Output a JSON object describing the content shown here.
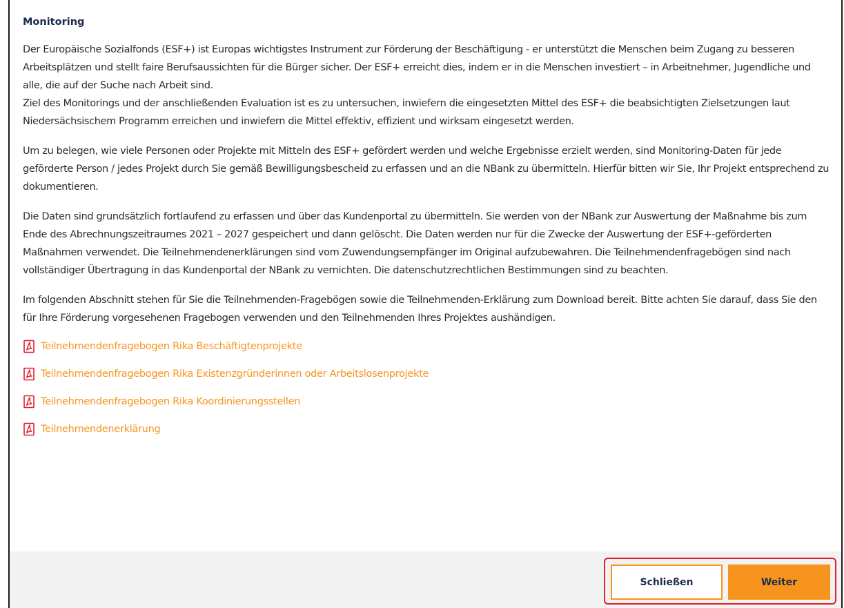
{
  "dialog": {
    "title": "Monitoring",
    "paragraphs": [
      "Der Europäische Sozialfonds (ESF+) ist Europas wichtigstes Instrument zur Förderung der Beschäftigung - er unterstützt die Menschen beim Zugang zu besseren Arbeitsplätzen und stellt faire Berufsaussichten für die Bürger sicher. Der ESF+ erreicht dies, indem er in die Menschen investiert – in Arbeitnehmer, Jugendliche und alle, die auf der Suche nach Arbeit sind.\nZiel des Monitorings und der anschließenden Evaluation ist es zu untersuchen, inwiefern die eingesetzten Mittel des ESF+ die beabsichtigten Zielsetzungen laut Niedersächsischem Programm erreichen und inwiefern die Mittel effektiv, effizient und wirksam eingesetzt werden.",
      "Um zu belegen, wie viele Personen oder Projekte mit Mitteln des ESF+ gefördert werden und welche Ergebnisse erzielt werden, sind Monitoring-Daten für jede geförderte Person / jedes Projekt durch Sie gemäß Bewilligungsbescheid zu erfassen und an die NBank zu übermitteln. Hierfür bitten wir Sie, Ihr Projekt entsprechend zu dokumentieren.",
      "Die Daten sind grundsätzlich fortlaufend zu erfassen und über das Kundenportal zu übermitteln. Sie werden von der NBank zur Auswertung der Maßnahme bis zum Ende des Abrechnungszeitraumes 2021 – 2027 gespeichert und dann gelöscht. Die Daten werden nur für die Zwecke der Auswertung der ESF+-geförderten Maßnahmen verwendet. Die Teilnehmendenerklärungen sind vom Zuwendungsempfänger im Original aufzubewahren. Die Teilnehmendenfragebögen sind nach vollständiger Übertragung in das Kundenportal der NBank zu vernichten. Die datenschutzrechtlichen Bestimmungen sind zu beachten.",
      "Im folgenden Abschnitt stehen für Sie die Teilnehmenden-Fragebögen sowie die Teilnehmenden-Erklärung zum Download bereit. Bitte achten Sie darauf, dass Sie den für Ihre Förderung vorgesehenen Fragebogen verwenden und den Teilnehmenden Ihres Projektes aushändigen."
    ],
    "links": [
      {
        "label": "Teilnehmendenfragebogen Rika Beschäftigtenprojekte",
        "icon": "pdf-icon"
      },
      {
        "label": "Teilnehmendenfragebogen Rika Existenzgründerinnen oder Arbeitslosenprojekte",
        "icon": "pdf-icon"
      },
      {
        "label": "Teilnehmendenfragebogen Rika Koordinierungsstellen",
        "icon": "pdf-icon"
      },
      {
        "label": "Teilnehmendenerklärung",
        "icon": "pdf-icon"
      }
    ]
  },
  "footer": {
    "close_label": "Schließen",
    "next_label": "Weiter"
  },
  "colors": {
    "accent": "#f7941d",
    "title": "#1d2b4f",
    "highlight": "#e0202a",
    "footer_bg": "#f2f2f2",
    "pdf_icon": "#e0202a"
  }
}
